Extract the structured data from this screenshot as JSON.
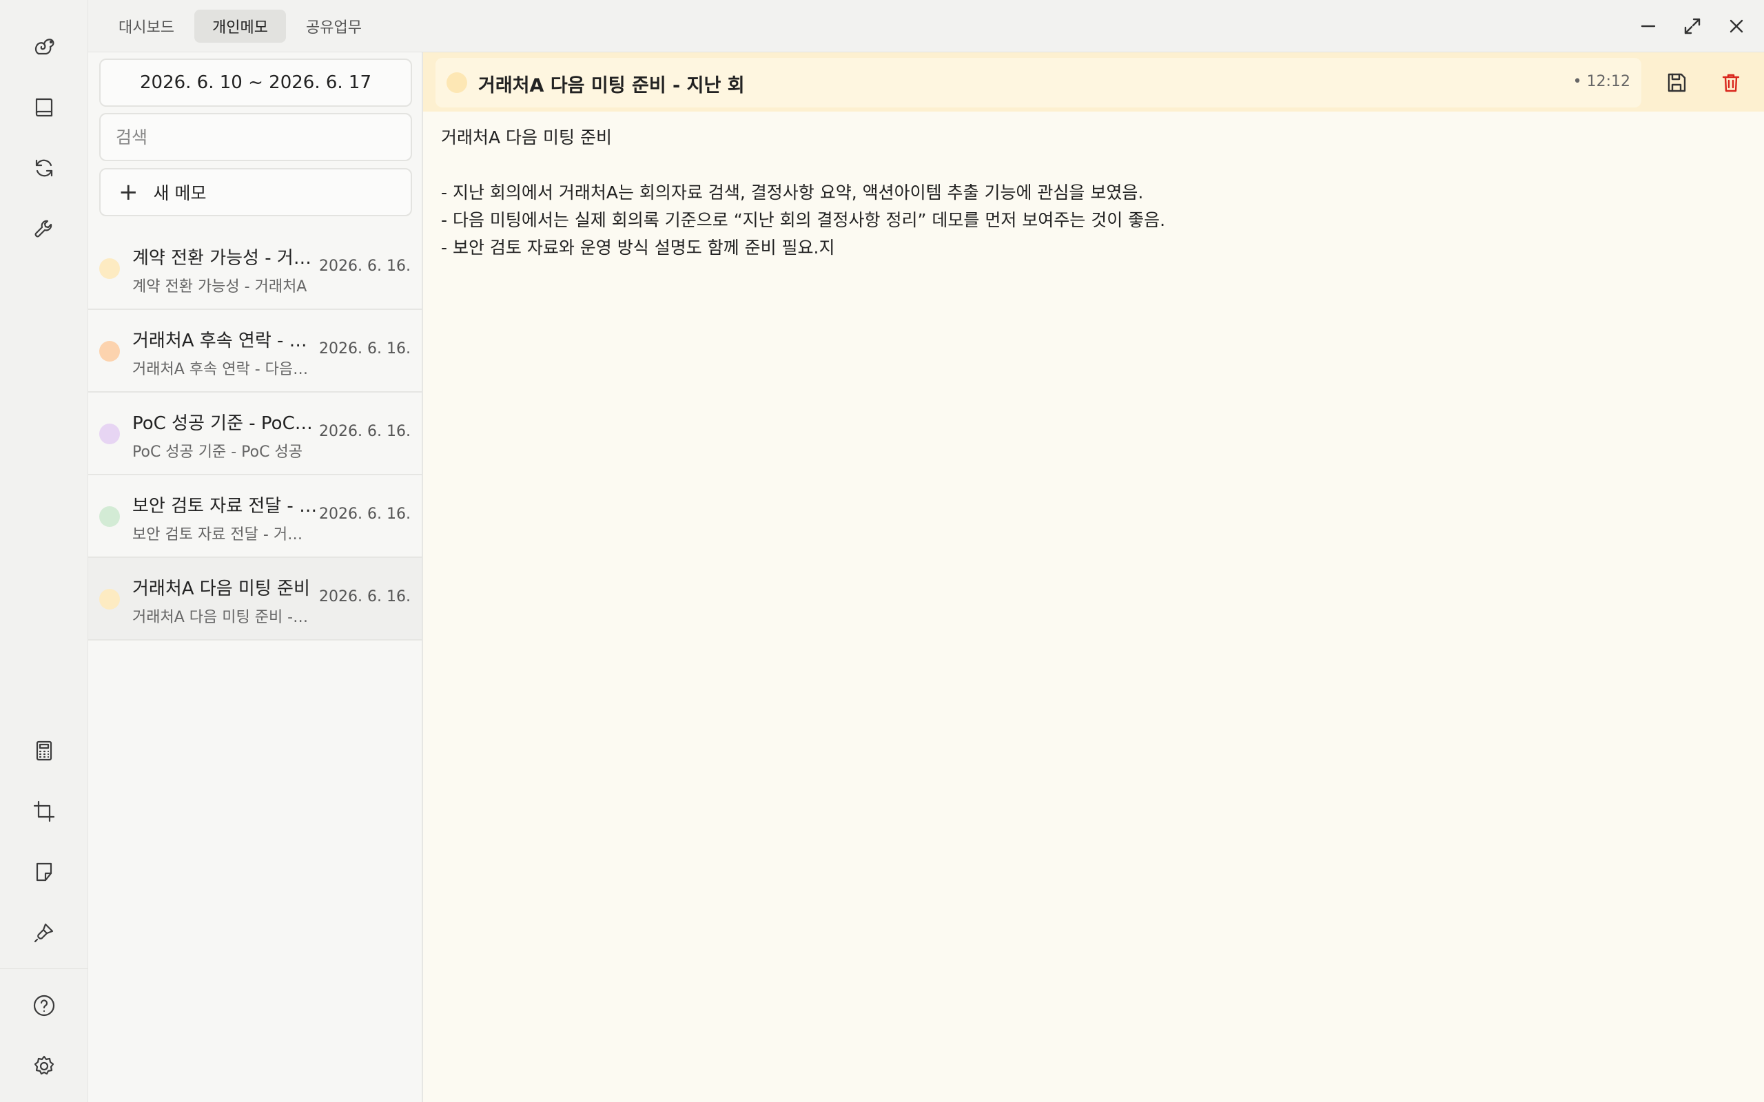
{
  "tabs": [
    "대시보드",
    "개인메모",
    "공유업무"
  ],
  "active_tab": "개인메모",
  "sidebar_icons": {
    "top": [
      "squirrel-logo-icon",
      "book-icon",
      "sync-icon",
      "wrench-icon"
    ],
    "bottom": [
      "calculator-icon",
      "crop-icon",
      "note-icon",
      "brush-icon",
      "help-icon",
      "settings-icon"
    ]
  },
  "window_controls": [
    "minimize-icon",
    "maximize-icon",
    "close-icon"
  ],
  "list": {
    "date_range": "2026. 6. 10 ~ 2026. 6. 17",
    "search_placeholder": "검색",
    "new_memo_label": "새 메모",
    "memos": [
      {
        "title": "계약 전환 가능성 - 거래처A",
        "preview": "계약 전환 가능성 - 거래처A",
        "date": "2026. 6. 16.",
        "color": "#fdebc2"
      },
      {
        "title": "거래처A 후속 연락 - 다음",
        "preview": "거래처A 후속 연락 - 다음 미팅",
        "date": "2026. 6. 16.",
        "color": "#fcd3ae"
      },
      {
        "title": "PoC 성공 기준 - PoC 성공",
        "preview": "PoC 성공 기준 - PoC 성공",
        "date": "2026. 6. 16.",
        "color": "#e7d5f3"
      },
      {
        "title": "보안 검토 자료 전달 - 거래처",
        "preview": "보안 검토 자료 전달 - 거래처",
        "date": "2026. 6. 16.",
        "color": "#d3ebd5"
      },
      {
        "title": "거래처A 다음 미팅 준비",
        "preview": "거래처A 다음 미팅 준비 - 지난",
        "date": "2026. 6. 16.",
        "color": "#fdebc2"
      }
    ]
  },
  "editor": {
    "title": "거래처A 다음 미팅 준비 - 지난 회",
    "time": "• 12:12",
    "color": "#fde7b4",
    "body": "거래처A 다음 미팅 준비\n\n- 지난 회의에서 거래처A는 회의자료 검색, 결정사항 요약, 액션아이템 추출 기능에 관심을 보였음.\n- 다음 미팅에서는 실제 회의록 기준으로 “지난 회의 결정사항 정리” 데모를 먼저 보여주는 것이 좋음.\n- 보안 검토 자료와 운영 방식 설명도 함께 준비 필요.지"
  },
  "colors": {
    "delete": "#d9261c",
    "header_bg": "#fdf0d0",
    "editor_bg": "#fcfaf2"
  }
}
